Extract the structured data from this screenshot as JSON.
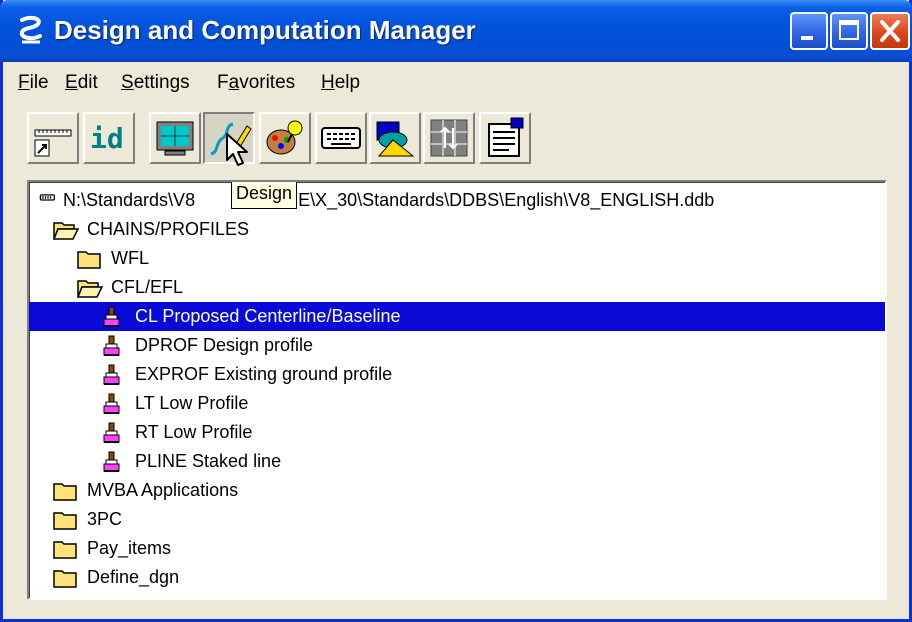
{
  "window": {
    "title": "Design and Computation Manager"
  },
  "menu": [
    "File",
    "Edit",
    "Settings",
    "Favorites",
    "Help"
  ],
  "menu_mnemonics": [
    "F",
    "E",
    "S",
    "a",
    "H"
  ],
  "toolbar": {
    "buttons": [
      {
        "name": "ruler-tool-button",
        "icon": "ruler-icon"
      },
      {
        "name": "id-tool-button",
        "icon": "id-icon",
        "text": "id"
      },
      {
        "name": "monitor-tool-button",
        "icon": "monitor-icon"
      },
      {
        "name": "design-tool-button",
        "icon": "design-pencil-icon",
        "pressed": true
      },
      {
        "name": "palette-tool-button",
        "icon": "palette-icon"
      },
      {
        "name": "keyboard-tool-button",
        "icon": "keyboard-icon"
      },
      {
        "name": "shapes-tool-button",
        "icon": "shapes-icon"
      },
      {
        "name": "grid-tool-button",
        "icon": "grid-icon"
      },
      {
        "name": "properties-tool-button",
        "icon": "properties-icon"
      }
    ],
    "tooltip": "Design"
  },
  "tree": {
    "root": "N:\\Standards\\V8 SOURCE\\X_30\\Standards\\DDBS\\English\\V8_ENGLISH.ddb",
    "root_visible_prefix": "N:\\Standards\\V8",
    "root_visible_suffix": "URCE\\X_30\\Standards\\DDBS\\English\\V8_ENGLISH.ddb",
    "nodes": [
      {
        "label": "CHAINS/PROFILES",
        "type": "folder-open",
        "level": 1
      },
      {
        "label": "WFL",
        "type": "folder",
        "level": 2
      },
      {
        "label": "CFL/EFL",
        "type": "folder-open",
        "level": 2
      },
      {
        "label": "CL Proposed Centerline/Baseline",
        "type": "item",
        "level": 3,
        "selected": true
      },
      {
        "label": "DPROF Design profile",
        "type": "item",
        "level": 3
      },
      {
        "label": "EXPROF Existing ground profile",
        "type": "item",
        "level": 3
      },
      {
        "label": "LT Low Profile",
        "type": "item",
        "level": 3
      },
      {
        "label": "RT Low Profile",
        "type": "item",
        "level": 3
      },
      {
        "label": "PLINE Staked line",
        "type": "item",
        "level": 3
      },
      {
        "label": "MVBA Applications",
        "type": "folder",
        "level": 1
      },
      {
        "label": "3PC",
        "type": "folder",
        "level": 1
      },
      {
        "label": "Pay_items",
        "type": "folder",
        "level": 1
      },
      {
        "label": "Define_dgn",
        "type": "folder",
        "level": 1
      }
    ]
  },
  "colors": {
    "title_bar": "#0353dc",
    "selection": "#0a0ad8",
    "folder": "#ffe27a",
    "tooltip_bg": "#ffffe1"
  }
}
